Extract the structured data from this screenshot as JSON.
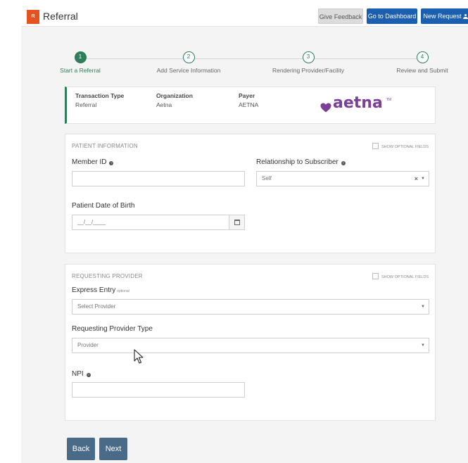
{
  "header": {
    "logo_text": "R",
    "title": "Referral",
    "give_feedback": "Give Feedback",
    "go_to_dashboard": "Go to Dashboard",
    "new_request": "New Request"
  },
  "stepper": {
    "steps": [
      {
        "number": "1",
        "label": "Start a Referral",
        "active": true
      },
      {
        "number": "2",
        "label": "Add Service Information",
        "active": false
      },
      {
        "number": "3",
        "label": "Rendering Provider/Facility",
        "active": false
      },
      {
        "number": "4",
        "label": "Review and Submit",
        "active": false
      }
    ]
  },
  "transaction": {
    "type_label": "Transaction Type",
    "type_value": "Referral",
    "org_label": "Organization",
    "org_value": "Aetna",
    "payer_label": "Payer",
    "payer_value": "AETNA",
    "payer_logo_text": "aetna",
    "trademark": "TM"
  },
  "patient": {
    "section_title": "PATIENT INFORMATION",
    "show_optional": "SHOW OPTIONAL FIELDS",
    "member_id_label": "Member ID",
    "member_id_value": "",
    "relationship_label": "Relationship to Subscriber",
    "relationship_value": "Self",
    "dob_label": "Patient Date of Birth",
    "dob_placeholder": "__/__/____"
  },
  "requesting": {
    "section_title": "REQUESTING PROVIDER",
    "show_optional": "SHOW OPTIONAL FIELDS",
    "express_label": "Express Entry",
    "express_note": "optional",
    "express_placeholder": "Select Provider",
    "type_label": "Requesting Provider Type",
    "type_value": "Provider",
    "npi_label": "NPI",
    "npi_value": ""
  },
  "footer": {
    "back": "Back",
    "next": "Next"
  },
  "colors": {
    "accent_green": "#2e7d5b",
    "header_blue": "#1b5fae",
    "aetna_purple": "#7b3f98",
    "logo_orange": "#e5531f",
    "footer_button": "#4a6b88"
  }
}
